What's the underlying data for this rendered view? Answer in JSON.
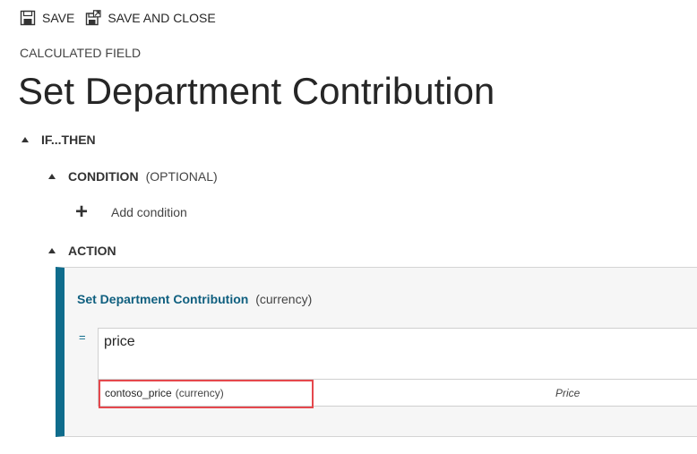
{
  "toolbar": {
    "save_label": "SAVE",
    "save_close_label": "SAVE AND CLOSE",
    "save_icon": "floppy-disk-icon",
    "save_close_icon": "save-and-close-icon"
  },
  "header": {
    "section_label": "CALCULATED FIELD",
    "title": "Set Department Contribution"
  },
  "tree": {
    "if_then_label": "IF...THEN",
    "condition": {
      "label": "CONDITION",
      "note": "(OPTIONAL)",
      "add_label": "Add condition",
      "add_icon": "plus-icon"
    },
    "action": {
      "label": "ACTION"
    }
  },
  "action_panel": {
    "target_field": "Set Department Contribution",
    "target_type": "(currency)",
    "equals_sign": "=",
    "expression": "price",
    "suggestions": [
      {
        "name": "contoso_price",
        "type": "(currency)",
        "display_name": "Price"
      }
    ]
  },
  "colors": {
    "accent": "#0f6c8c",
    "highlight": "#e5484d",
    "panel_bg": "#f6f6f6"
  }
}
